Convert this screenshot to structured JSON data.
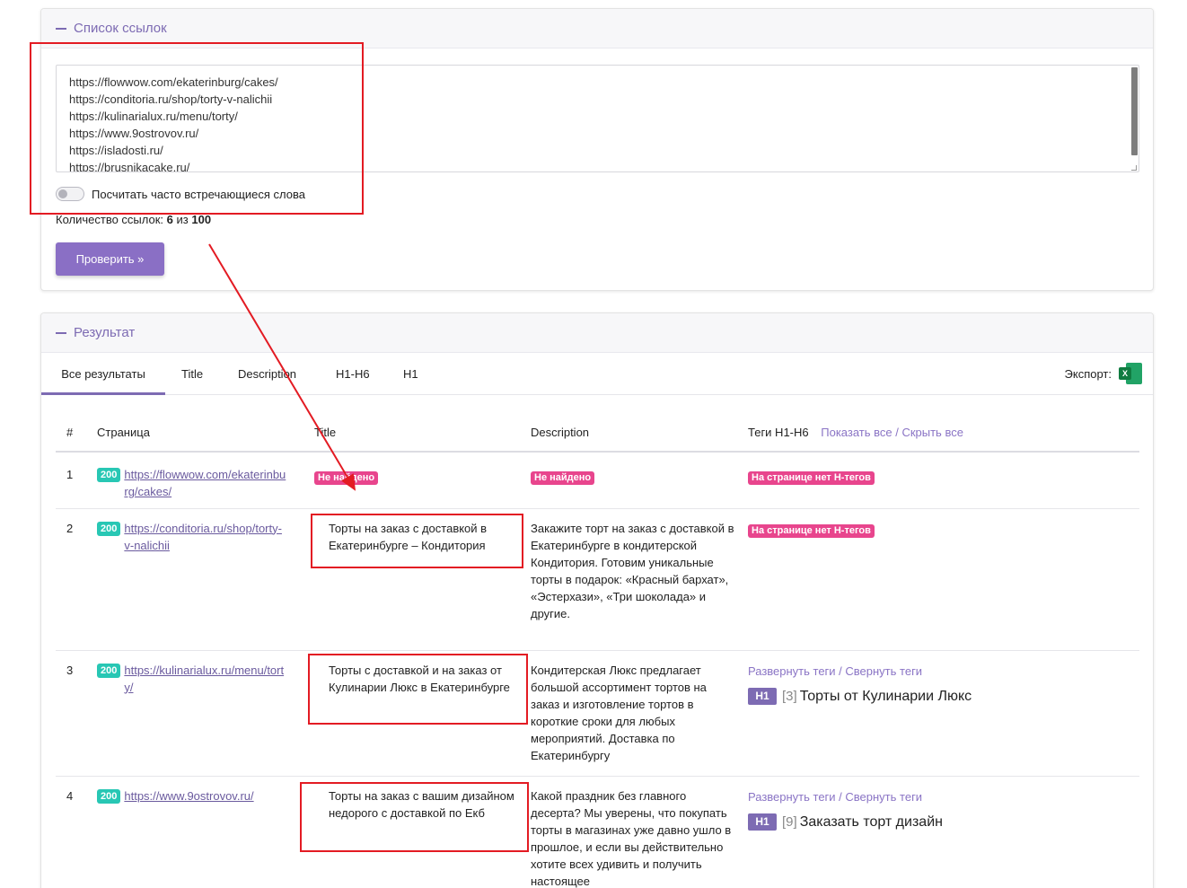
{
  "links_card": {
    "title": "Список ссылок",
    "urls": [
      "https://flowwow.com/ekaterinburg/cakes/",
      "https://conditoria.ru/shop/torty-v-nalichii",
      "https://kulinarialux.ru/menu/torty/",
      "https://www.9ostrovov.ru/",
      "https://isladosti.ru/",
      "https://brusnikacake.ru/"
    ],
    "toggle_label": "Посчитать часто встречающиеся слова",
    "count_prefix": "Количество ссылок:",
    "count_value": "6",
    "count_of": "из",
    "count_max": "100",
    "check_button": "Проверить »"
  },
  "result_card": {
    "title": "Результат",
    "tabs": [
      "Все результаты",
      "Title",
      "Description",
      "H1-H6",
      "H1"
    ],
    "export_label": "Экспорт:",
    "columns": {
      "num": "#",
      "page": "Страница",
      "title": "Title",
      "description": "Description",
      "tags": "Теги H1-H6",
      "show_hide": "Показать все / Скрыть все"
    },
    "rows": [
      {
        "num": "1",
        "status": "200",
        "url": "https://flowwow.com/ekaterinburg/cakes/",
        "title_badge": "Не найдено",
        "desc_badge": "Не найдено",
        "tags_badge": "На странице нет Н-тегов"
      },
      {
        "num": "2",
        "status": "200",
        "url": "https://conditoria.ru/shop/torty-v-nalichii",
        "title": "Торты на заказ с доставкой в Екатеринбурге – Кондитория",
        "description": "Закажите торт на заказ с доставкой в Екатеринбурге в кондитерской Кондитория. Готовим уникальные торты в подарок: «Красный бархат», «Эстерхази», «Три шоколада» и другие.",
        "tags_badge": "На странице нет Н-тегов"
      },
      {
        "num": "3",
        "status": "200",
        "url": "https://kulinarialux.ru/menu/torty/",
        "title": "Торты с доставкой и на заказ от Кулинарии Люкс в Екатеринбурге",
        "description": "Кондитерская Люкс предлагает большой ассортимент тортов на заказ и изготовление тортов в короткие сроки для любых мероприятий. Доставка по Екатеринбургу",
        "expand": "Развернуть теги / Свернуть теги",
        "h_tag": "H1",
        "h_count": "[3]",
        "h_text": "Торты от Кулинарии Люкс"
      },
      {
        "num": "4",
        "status": "200",
        "url": "https://www.9ostrovov.ru/",
        "title": "Торты на заказ с вашим дизайном недорого с доставкой по Екб",
        "description": "Какой праздник без главного десерта? Мы уверены, что покупать торты в магазинах уже давно ушло в прошлое, и если вы действительно хотите всех удивить и получить настоящее",
        "expand": "Развернуть теги / Свернуть теги",
        "h_tag": "H1",
        "h_count": "[9]",
        "h_text": "Заказать торт дизайн"
      }
    ]
  },
  "colors": {
    "accent": "#7d6bb3",
    "button": "#8a6fc5",
    "status_ok": "#28c7b4",
    "not_found": "#e8458d",
    "annotation": "#e31b23"
  },
  "icons": {
    "export": "excel-icon"
  }
}
